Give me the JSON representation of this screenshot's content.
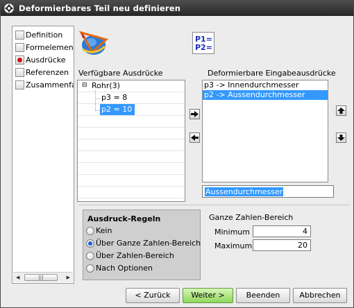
{
  "window": {
    "title": "Deformierbares Teil neu definieren"
  },
  "nav": {
    "items": [
      {
        "label": "Definition",
        "active": false
      },
      {
        "label": "Formelement",
        "active": false
      },
      {
        "label": "Ausdrücke",
        "active": true
      },
      {
        "label": "Referenzen",
        "active": false
      },
      {
        "label": "Zusammenfassung",
        "active": false
      }
    ]
  },
  "p_icon": {
    "line1": "P1=",
    "line2": "P2="
  },
  "available": {
    "label": "Verfügbare Ausdrücke",
    "root": "Rohr(3)",
    "items": [
      "p3 = 8",
      "p2 = 10"
    ]
  },
  "deformable": {
    "label": "Deformierbare Eingabeausdrücke",
    "items": [
      "p3 -> Innendurchmesser",
      "p2 -> Aussendurchmesser"
    ],
    "name_value": "Aussendurchmesser"
  },
  "rules": {
    "title": "Ausdruck-Regeln",
    "options": [
      {
        "label": "Kein",
        "selected": false
      },
      {
        "label": "Über Ganze Zahlen-Bereich",
        "selected": true
      },
      {
        "label": "Über Zahlen-Bereich",
        "selected": false
      },
      {
        "label": "Nach Optionen",
        "selected": false
      }
    ]
  },
  "range": {
    "title": "Ganze Zahlen-Bereich",
    "min_label": "Minimum",
    "min_value": "4",
    "max_label": "Maximum",
    "max_value": "20"
  },
  "buttons": {
    "back": "< Zurück",
    "next": "Weiter >",
    "finish": "Beenden",
    "cancel": "Abbrechen"
  },
  "colors": {
    "selection": "#3399ff",
    "titlebar": "#333333",
    "radio_active": "#d81010"
  }
}
